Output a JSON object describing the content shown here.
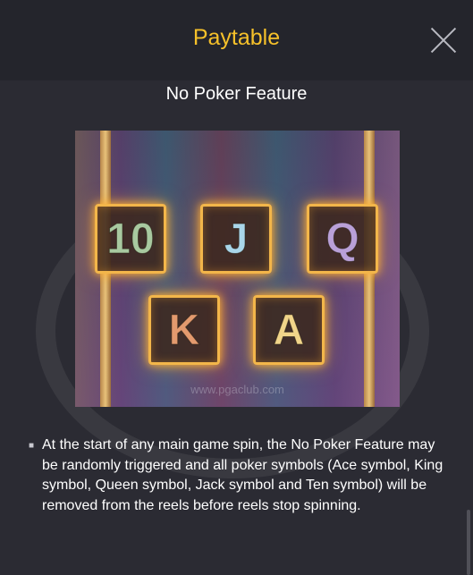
{
  "header": {
    "title": "Paytable"
  },
  "section": {
    "heading": "No Poker Feature"
  },
  "image": {
    "watermark": "www.pgaclub.com",
    "symbols": [
      {
        "label": "10",
        "color": "#a8c9a0"
      },
      {
        "label": "J",
        "color": "#a9d6ea"
      },
      {
        "label": "Q",
        "color": "#b9a0d8"
      },
      {
        "label": "K",
        "color": "#e39a6e"
      },
      {
        "label": "A",
        "color": "#f1d58a"
      }
    ]
  },
  "description": {
    "text": "At the start of any main game spin, the No Poker Feature may be randomly triggered and all poker symbols (Ace symbol, King symbol, Queen symbol, Jack symbol and Ten symbol) will be removed from the reels before reels stop spinning."
  },
  "colors": {
    "accent": "#f6c12a",
    "background": "#2b2b33",
    "header_bg": "#24252c"
  }
}
